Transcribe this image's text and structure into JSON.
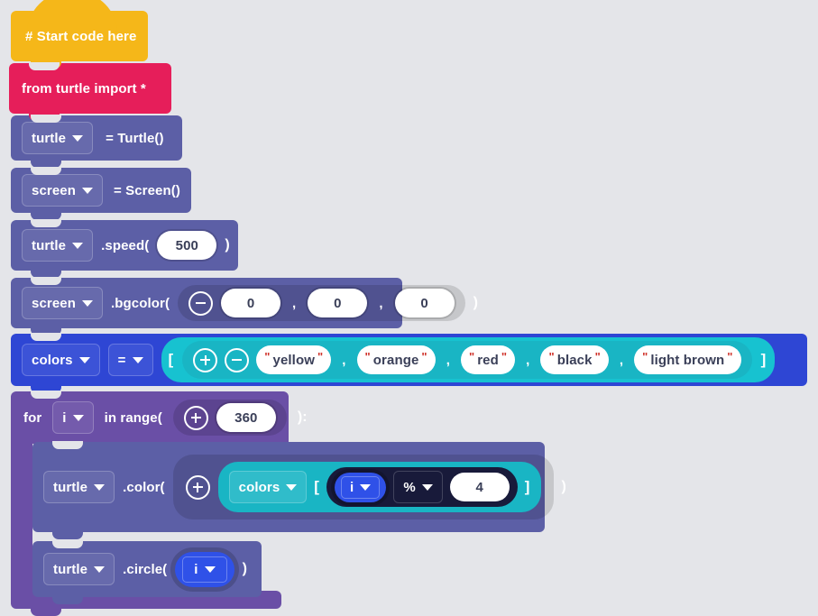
{
  "canvas": {
    "background": "#e4e5e9"
  },
  "palette": {
    "comment": "#f5b719",
    "import": "#e61e5a",
    "statement": "#5c5fa6",
    "assign_list": "#2e46d4",
    "loop": "#6a4fa6",
    "list_container": "#19b5c4",
    "expression_dark": "#181a3a",
    "variable_pill": "#2f51e8",
    "field_text": "#ffffff",
    "value_text": "#3a3f58",
    "quote_mark": "#d0342c"
  },
  "blocks": {
    "comment": {
      "label": "# Start code here"
    },
    "import": {
      "label": "from turtle import *"
    },
    "turtle_assign": {
      "variable": "turtle",
      "expression": "= Turtle()"
    },
    "screen_assign": {
      "variable": "screen",
      "expression": "= Screen()"
    },
    "speed": {
      "variable": "turtle",
      "method": ".speed(",
      "value": "500",
      "close": ")"
    },
    "bgcolor": {
      "variable": "screen",
      "method": ".bgcolor(",
      "minus_icon": "minus-circle-icon",
      "r": "0",
      "g": "0",
      "b": "0",
      "comma": ",",
      "close": ")"
    },
    "colors_assign": {
      "variable": "colors",
      "operator": "=",
      "open_bracket": "[",
      "plus_icon": "plus-circle-icon",
      "minus_icon": "minus-circle-icon",
      "items": [
        "yellow",
        "orange",
        "red",
        "black",
        "light brown"
      ],
      "quote": "\"",
      "comma": ",",
      "close_bracket": "]"
    },
    "for_loop": {
      "keyword": "for",
      "variable": "i",
      "in_range": "in range(",
      "plus_icon": "plus-circle-icon",
      "count": "360",
      "close": "):"
    },
    "set_color": {
      "variable": "turtle",
      "method": ".color(",
      "plus_icon": "plus-circle-icon",
      "list_variable": "colors",
      "open_bracket": "[",
      "index_variable": "i",
      "operator": "%",
      "modulus": "4",
      "close_bracket": "]",
      "close": ")"
    },
    "circle": {
      "variable": "turtle",
      "method": ".circle(",
      "argument": "i",
      "close": ")"
    }
  }
}
